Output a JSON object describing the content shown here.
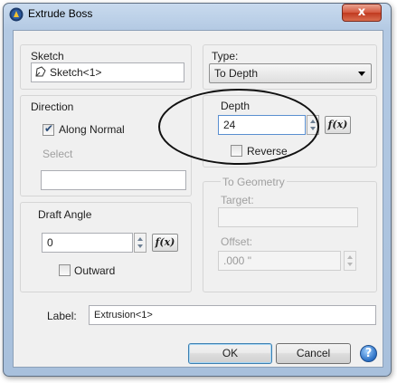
{
  "window": {
    "title": "Extrude Boss",
    "close_glyph": "x"
  },
  "sketch": {
    "label": "Sketch",
    "value": "Sketch<1>",
    "icon": "sketch-icon"
  },
  "type": {
    "label": "Type:",
    "selected": "To Depth"
  },
  "direction": {
    "group_label": "Direction",
    "along_normal_label": "Along Normal",
    "along_normal_checked": true,
    "select_label": "Select",
    "select_value": ""
  },
  "depth": {
    "group_label": "Depth",
    "value": "24",
    "fx_label": "f(x)",
    "reverse_label": "Reverse",
    "reverse_checked": false
  },
  "to_geometry": {
    "group_label": "To Geometry",
    "target_label": "Target:",
    "target_value": "",
    "offset_label": "Offset:",
    "offset_value": ".000 \""
  },
  "draft_angle": {
    "group_label": "Draft Angle",
    "value": "0",
    "fx_label": "f(x)",
    "outward_label": "Outward",
    "outward_checked": false
  },
  "label_field": {
    "label": "Label:",
    "value": "Extrusion<1>"
  },
  "buttons": {
    "ok": "OK",
    "cancel": "Cancel",
    "help_glyph": "?"
  },
  "colors": {
    "frame": "#b3c9e3",
    "close": "#c0391f",
    "dialog_bg": "#f0f0f0",
    "help": "#2a6fc4"
  }
}
